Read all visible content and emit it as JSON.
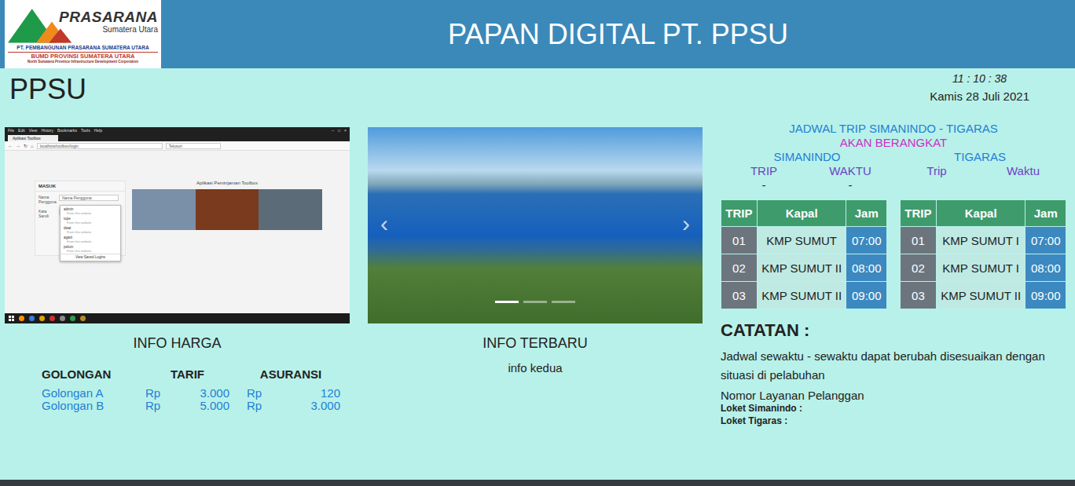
{
  "header": {
    "logo": {
      "name": "PRASARANA",
      "sub": "Sumatera Utara",
      "line1": "PT. PEMBANGUNAN PRASARANA SUMATERA UTARA",
      "line2": "BUMD PROVINSI SUMATERA UTARA",
      "line3": "North Sumatera Province Infrastructure Development Corporation"
    },
    "title": "PAPAN DIGITAL PT. PPSU"
  },
  "brand": "PPSU",
  "clock": {
    "time": "11 : 10 : 38",
    "date": "Kamis 28 Juli 2021"
  },
  "app_window": {
    "menu": [
      "File",
      "Edit",
      "View",
      "History",
      "Bookmarks",
      "Tools",
      "Help"
    ],
    "controls": [
      "–",
      "□",
      "×"
    ],
    "tab": "Aplikasi Toolbox",
    "nav": [
      "←",
      "→",
      "↻",
      "⌂"
    ],
    "address": "localhost/toolbox/login",
    "search": "Telusuri",
    "login": {
      "title": "MASUK",
      "fields": [
        {
          "label": "Nama Pengguna",
          "placeholder": "Nama Pengguna"
        },
        {
          "label": "Kata Sandi",
          "placeholder": ""
        }
      ],
      "suggestions": [
        "admin",
        "tope",
        "dwai",
        "agani",
        "pelum"
      ],
      "suggestion_note": "From this website",
      "manage": "View Saved Logins"
    },
    "heading": "Aplikasi Peminjaman Toolbox"
  },
  "carousel": {
    "prev": "‹",
    "next": "›",
    "indicators": [
      {
        "selected": true
      },
      {
        "selected": false
      },
      {
        "selected": false
      }
    ]
  },
  "info_harga": {
    "title": "INFO HARGA",
    "columns": [
      "GOLONGAN",
      "TARIF",
      "ASURANSI"
    ],
    "rows": [
      {
        "golongan": "Golongan A",
        "tarif_currency": "Rp",
        "tarif": "3.000",
        "asuransi_currency": "Rp",
        "asuransi": "120"
      },
      {
        "golongan": "Golongan B",
        "tarif_currency": "Rp",
        "tarif": "5.000",
        "asuransi_currency": "Rp",
        "asuransi": "3.000"
      }
    ]
  },
  "info_terbaru": {
    "title": "INFO TERBARU",
    "text": "info kedua"
  },
  "schedule": {
    "title": "JADWAL TRIP SIMANINDO - TIGARAS",
    "status": "AKAN BERANGKAT",
    "ports": [
      {
        "name": "SIMANINDO",
        "labels": [
          "TRIP",
          "WAKTU"
        ],
        "values": [
          "-",
          "-"
        ]
      },
      {
        "name": "TIGARAS",
        "labels": [
          "Trip",
          "Waktu"
        ],
        "values": []
      }
    ],
    "tables": [
      {
        "columns": [
          "TRIP",
          "Kapal",
          "Jam"
        ],
        "rows": [
          [
            "01",
            "KMP SUMUT",
            "07:00"
          ],
          [
            "02",
            "KMP SUMUT II",
            "08:00"
          ],
          [
            "03",
            "KMP SUMUT II",
            "09:00"
          ]
        ]
      },
      {
        "columns": [
          "TRIP",
          "Kapal",
          "Jam"
        ],
        "rows": [
          [
            "01",
            "KMP SUMUT I",
            "07:00"
          ],
          [
            "02",
            "KMP SUMUT I",
            "08:00"
          ],
          [
            "03",
            "KMP SUMUT II",
            "09:00"
          ]
        ]
      }
    ]
  },
  "notes": {
    "title": "CATATAN :",
    "text": "Jadwal sewaktu - sewaktu dapat berubah disesuaikan dengan situasi di pelabuhan",
    "service_title": "Nomor Layanan Pelanggan",
    "lines": [
      "Loket Simanindo :",
      "Loket Tigaras :"
    ]
  }
}
